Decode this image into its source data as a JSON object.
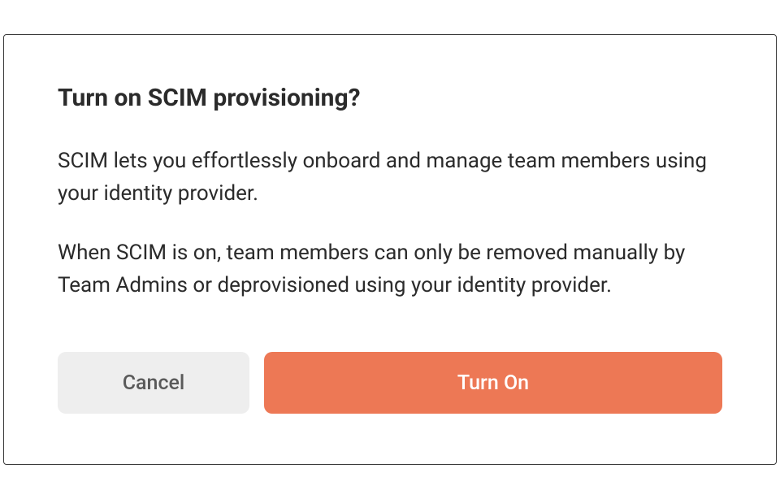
{
  "dialog": {
    "title": "Turn on SCIM provisioning?",
    "paragraph1": "SCIM lets you effortlessly onboard and manage team members using your identity provider.",
    "paragraph2": "When SCIM is on, team members can only be removed manually by Team Admins or deprovisioned using your identity provider.",
    "cancel_label": "Cancel",
    "confirm_label": "Turn On"
  },
  "colors": {
    "primary": "#ed7855",
    "secondary_bg": "#eeeeee",
    "text": "#2b2b2b"
  }
}
